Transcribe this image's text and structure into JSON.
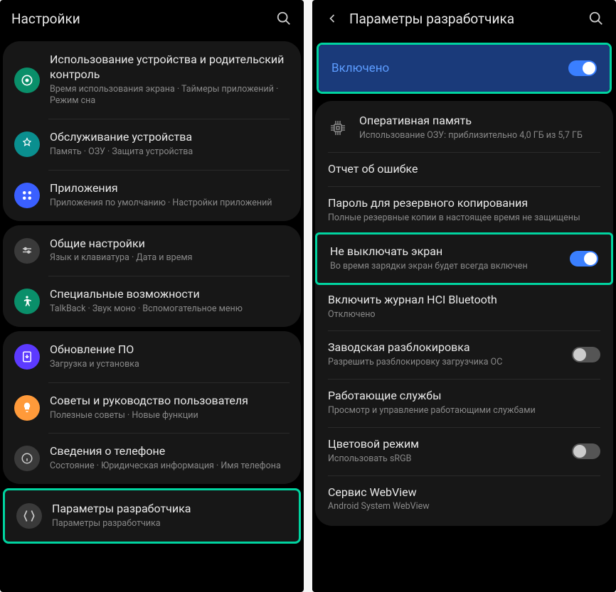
{
  "left": {
    "header": {
      "title": "Настройки"
    },
    "groups": [
      {
        "items": [
          {
            "icon": "wellbeing-icon",
            "iconClass": "ic-green",
            "title": "Использование устройства и родительский контроль",
            "sub": "Время использования экрана  ·  Таймеры приложений  ·  Режим сна"
          },
          {
            "icon": "care-icon",
            "iconClass": "ic-teal",
            "title": "Обслуживание устройства",
            "sub": "Память  ·  ОЗУ  ·  Защита устройства"
          },
          {
            "icon": "apps-icon",
            "iconClass": "ic-blue",
            "title": "Приложения",
            "sub": "Приложения по умолчанию  ·  Настройки приложений"
          }
        ]
      },
      {
        "items": [
          {
            "icon": "general-icon",
            "iconClass": "ic-gray",
            "title": "Общие настройки",
            "sub": "Язык и клавиатура  ·  Дата и время"
          },
          {
            "icon": "accessibility-icon",
            "iconClass": "ic-green",
            "title": "Специальные возможности",
            "sub": "TalkBack  ·  Звук моно  ·  Вспомогательное меню"
          }
        ]
      },
      {
        "items": [
          {
            "icon": "update-icon",
            "iconClass": "ic-purple",
            "title": "Обновление ПО",
            "sub": "Загрузка и установка"
          },
          {
            "icon": "tips-icon",
            "iconClass": "ic-orange",
            "title": "Советы и руководство пользователя",
            "sub": "Полезные советы  ·  Новые функции"
          },
          {
            "icon": "about-icon",
            "iconClass": "ic-gray",
            "title": "Сведения о телефоне",
            "sub": "Состояние  ·  Юридическая информация  ·  Имя телефона"
          }
        ]
      },
      {
        "highlight": true,
        "items": [
          {
            "icon": "developer-icon",
            "iconClass": "ic-gray",
            "title": "Параметры разработчика",
            "sub": "Параметры разработчика"
          }
        ]
      }
    ]
  },
  "right": {
    "header": {
      "title": "Параметры разработчика"
    },
    "enabled": {
      "label": "Включено",
      "on": true,
      "highlight": true
    },
    "items": [
      {
        "kind": "mem",
        "title": "Оперативная память",
        "sub": "Использование ОЗУ: приблизительно 4,0 ГБ из 5,7 ГБ"
      },
      {
        "kind": "plain",
        "title": "Отчет об ошибке"
      },
      {
        "kind": "plain",
        "title": "Пароль для резервного копирования",
        "sub": "Полные резервные копии в настоящее время не защищены"
      },
      {
        "kind": "toggle",
        "title": "Не выключать экран",
        "sub": "Во время зарядки экран будет всегда включен",
        "on": true,
        "highlight": true
      },
      {
        "kind": "plain",
        "title": "Включить журнал HCI Bluetooth",
        "sub": "Отключено"
      },
      {
        "kind": "toggle",
        "title": "Заводская разблокировка",
        "sub": "Разрешить разблокировку загрузчика ОС",
        "on": false
      },
      {
        "kind": "plain",
        "title": "Работающие службы",
        "sub": "Просмотр и управление работающими службами"
      },
      {
        "kind": "toggle",
        "title": "Цветовой режим",
        "sub": "Использовать sRGB",
        "on": false
      },
      {
        "kind": "plain",
        "title": "Сервис WebView",
        "sub": "Android System WebView"
      }
    ]
  }
}
